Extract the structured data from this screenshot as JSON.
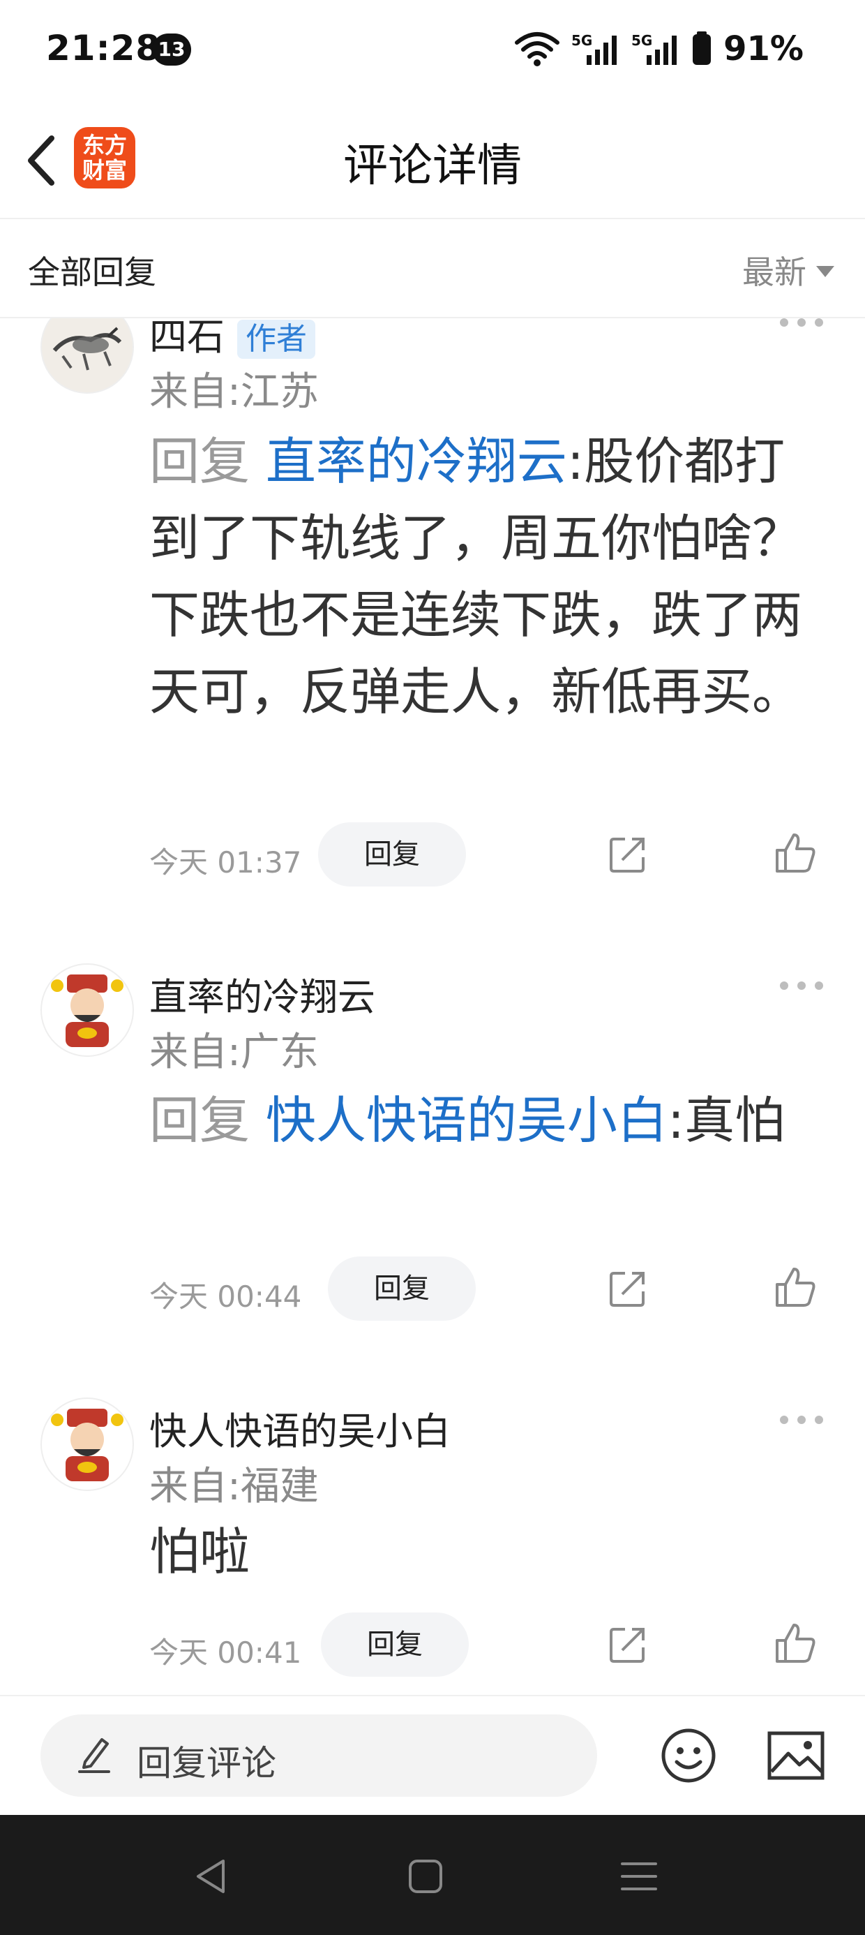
{
  "status_bar": {
    "time": "21:28",
    "notification_count": "13",
    "network_1": "5G",
    "network_2": "5G",
    "battery": "91%"
  },
  "nav": {
    "logo_text": "东方财富",
    "title": "评论详情"
  },
  "filter": {
    "all_replies": "全部回复",
    "sort": "最新"
  },
  "comments": [
    {
      "username": "四石",
      "badge": "作者",
      "location": "来自:江苏",
      "reply_prefix": "回复",
      "reply_to": "直率的冷翔云",
      "text": ":股价都打到了下轨线了，周五你怕啥？下跌也不是连续下跌，跌了两天可，反弹走人，新低再买。",
      "time": "今天 01:37",
      "reply_button": "回复"
    },
    {
      "username": "直率的冷翔云",
      "location": "来自:广东",
      "reply_prefix": "回复",
      "reply_to": "快人快语的吴小白",
      "text": ":真怕",
      "time": "今天 00:44",
      "reply_button": "回复"
    },
    {
      "username": "快人快语的吴小白",
      "location": "来自:福建",
      "text": "怕啦",
      "time": "今天 00:41",
      "reply_button": "回复"
    }
  ],
  "bottom_bar": {
    "input_placeholder": "回复评论"
  },
  "icons": [
    "back-arrow-icon",
    "more-icon",
    "share-icon",
    "thumbs-up-icon",
    "pencil-icon",
    "emoji-icon",
    "image-icon",
    "nav-back-icon",
    "nav-home-icon",
    "nav-menu-icon"
  ],
  "colors": {
    "brand": "#ef4c1a",
    "link": "#1d6fc8",
    "badge_bg": "#e4f0fb"
  }
}
